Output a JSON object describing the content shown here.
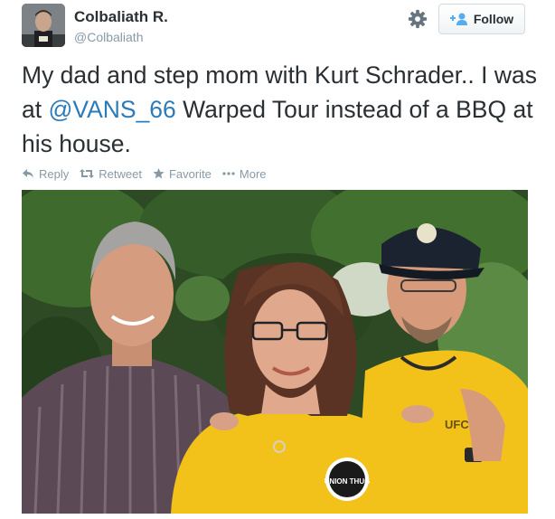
{
  "header": {
    "display_name": "Colbaliath R.",
    "handle": "@Colbaliath",
    "settings_icon": "gear-icon",
    "follow_label": "Follow",
    "follow_icon": "add-user-icon"
  },
  "tweet": {
    "text_before": "My dad and step mom with Kurt Schrader.. I was at ",
    "mention": "@VANS_66",
    "text_after": " Warped Tour instead of a BBQ at his house.",
    "mention_color": "#2b7bb9"
  },
  "actions": [
    {
      "label": "Reply",
      "icon": "reply-icon"
    },
    {
      "label": "Retweet",
      "icon": "retweet-icon"
    },
    {
      "label": "Favorite",
      "icon": "star-icon"
    },
    {
      "label": "More",
      "icon": "more-dots-icon"
    }
  ],
  "photo": {
    "shirt_logo_left": "UNION THUG",
    "shirt_logo_right": "UFCW"
  },
  "colors": {
    "text": "#292f33",
    "muted": "#8899a6",
    "link": "#2b7bb9",
    "shirt_yellow": "#f2c21b"
  }
}
